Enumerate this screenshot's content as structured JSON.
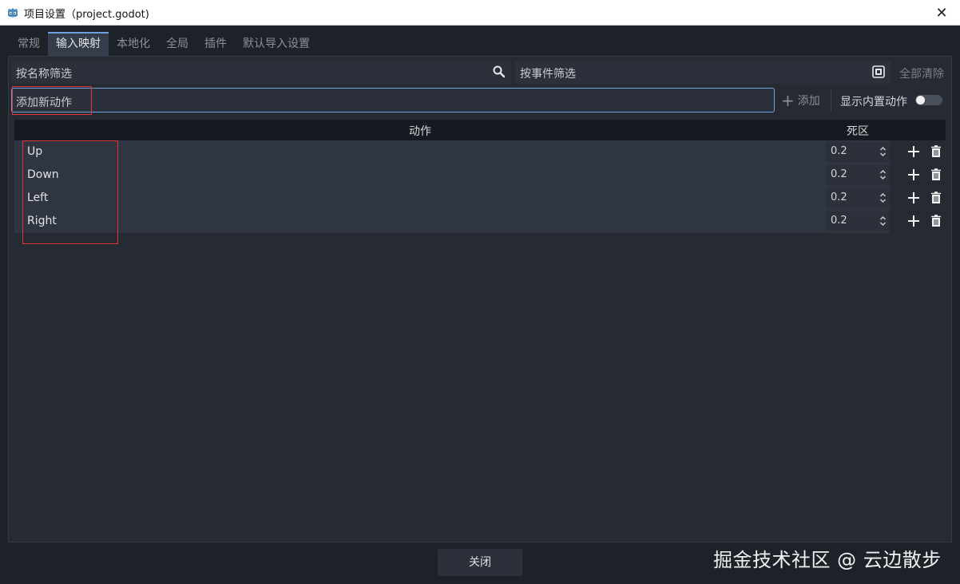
{
  "window": {
    "title": "项目设置（project.godot)",
    "close_glyph": "✕"
  },
  "tabs": [
    {
      "label": "常规",
      "active": false
    },
    {
      "label": "输入映射",
      "active": true
    },
    {
      "label": "本地化",
      "active": false
    },
    {
      "label": "全局",
      "active": false
    },
    {
      "label": "插件",
      "active": false
    },
    {
      "label": "默认导入设置",
      "active": false
    }
  ],
  "filters": {
    "name_placeholder": "按名称筛选",
    "event_placeholder": "按事件筛选",
    "clear_all": "全部清除"
  },
  "add_action": {
    "placeholder": "添加新动作",
    "add_label": "添加",
    "show_builtin_label": "显示内置动作",
    "show_builtin_enabled": false
  },
  "table": {
    "col_action": "动作",
    "col_deadzone": "死区",
    "rows": [
      {
        "name": "Up",
        "deadzone": "0.2"
      },
      {
        "name": "Down",
        "deadzone": "0.2"
      },
      {
        "name": "Left",
        "deadzone": "0.2"
      },
      {
        "name": "Right",
        "deadzone": "0.2"
      }
    ]
  },
  "footer": {
    "close_label": "关闭"
  },
  "watermark": "掘金技术社区 @ 云边散步",
  "colors": {
    "accent": "#6fa0e0",
    "highlight_box": "#e23636",
    "background": "#1d2128"
  }
}
